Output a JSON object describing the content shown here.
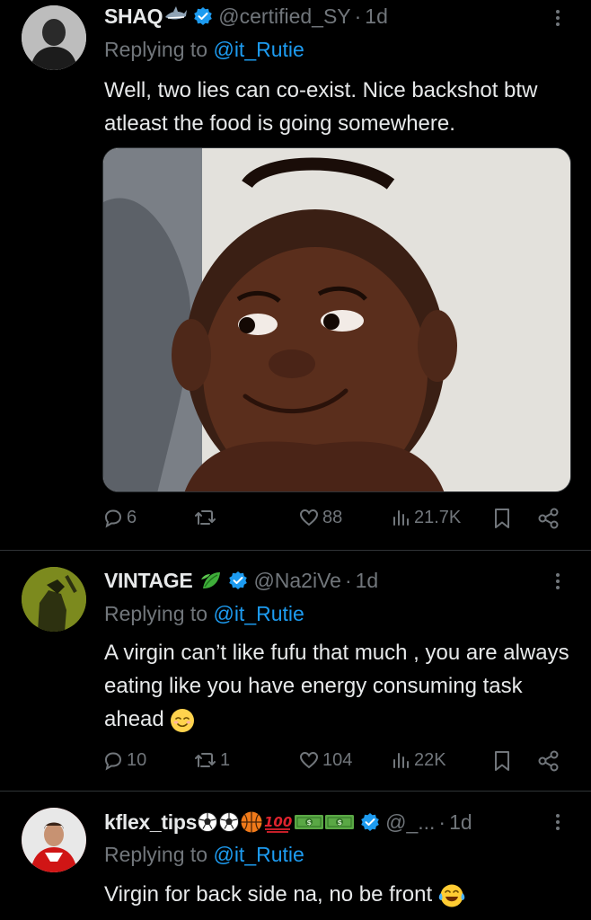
{
  "tweets": [
    {
      "name": "SHAQ",
      "name_emoji": "shark-emoji",
      "handle": "@certified_SY",
      "time": "1d",
      "reply_prefix": "Replying to",
      "reply_to": "@it_Rutie",
      "text": "Well, two lies can co-exist. Nice backshot btw atleast the food is going somewhere.",
      "has_image": true,
      "stats": {
        "replies": "6",
        "retweets": "",
        "likes": "88",
        "views": "21.7K"
      }
    },
    {
      "name": "VINTAGE",
      "name_emoji": "leaf-emoji",
      "handle": "@Na2iVe",
      "time": "1d",
      "reply_prefix": "Replying to",
      "reply_to": "@it_Rutie",
      "text": "A virgin can’t like fufu that much , you are always eating like you have energy consuming task ahead",
      "text_emoji": "relieved-face-emoji",
      "stats": {
        "replies": "10",
        "retweets": "1",
        "likes": "104",
        "views": "22K"
      }
    },
    {
      "name": "kflex_tips",
      "name_emoji": "soccer-soccer-basketball-100-money-money",
      "handle": "@_...",
      "time": "1d",
      "reply_prefix": "Replying to",
      "reply_to": "@it_Rutie",
      "text": "Virgin for back side na, no be front",
      "text_emoji": "tears-of-joy-emoji"
    }
  ],
  "colors": {
    "background": "#000000",
    "text": "#e7e9ea",
    "muted": "#71767b",
    "accent": "#1d9bf0",
    "divider": "#2f3336"
  }
}
